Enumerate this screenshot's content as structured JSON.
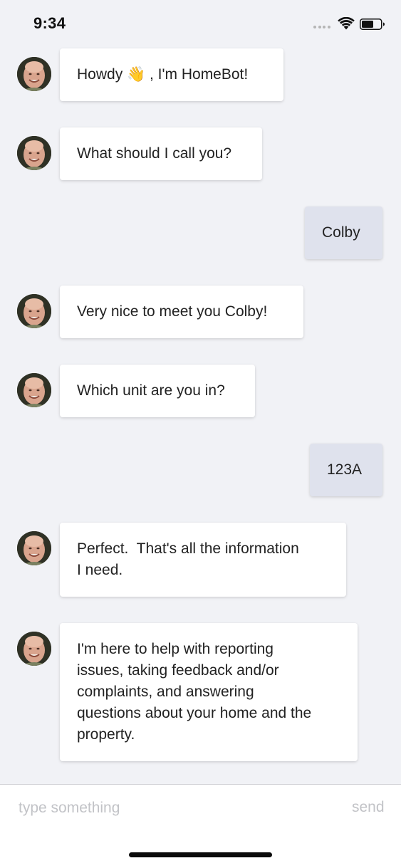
{
  "status_bar": {
    "time": "9:34"
  },
  "bot": {
    "avatar_icon": "bot-avatar-face"
  },
  "messages": [
    {
      "sender": "bot",
      "text": "Howdy 👋 , I'm HomeBot!"
    },
    {
      "sender": "bot",
      "text": "What should I call you?"
    },
    {
      "sender": "user",
      "text": "Colby"
    },
    {
      "sender": "bot",
      "text": "Very nice to meet you Colby!"
    },
    {
      "sender": "bot",
      "text": "Which unit are you in?"
    },
    {
      "sender": "user",
      "text": "123A"
    },
    {
      "sender": "bot",
      "text": "Perfect.  That's all the information\nI need."
    },
    {
      "sender": "bot",
      "text": "I'm here to help with reporting\nissues, taking feedback and/or\ncomplaints, and answering\nquestions about your home and the\nproperty."
    }
  ],
  "composer": {
    "placeholder": "type something",
    "value": "",
    "send_label": "send"
  },
  "colors": {
    "background": "#f1f2f6",
    "bot_bubble": "#ffffff",
    "user_bubble": "#dfe2ed",
    "placeholder": "#c2c3c7"
  }
}
